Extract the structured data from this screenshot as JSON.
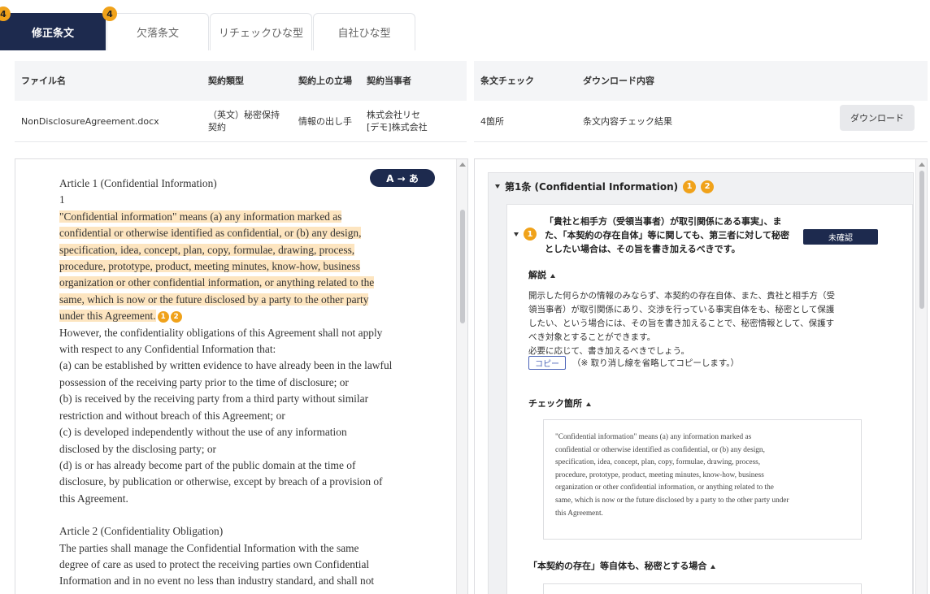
{
  "tabs": [
    {
      "label": "修正条文",
      "badge": "4",
      "active": true
    },
    {
      "label": "欠落条文",
      "badge": "4",
      "active": false
    },
    {
      "label": "リチェックひな型",
      "badge": "",
      "active": false
    },
    {
      "label": "自社ひな型",
      "badge": "",
      "active": false
    }
  ],
  "file_table": {
    "headers": [
      "ファイル名",
      "契約類型",
      "契約上の立場",
      "契約当事者"
    ],
    "file_name": "NonDisclosureAgreement.docx",
    "contract_type": [
      "（英文）秘密保持",
      "契約"
    ],
    "position": "情報の出し手",
    "parties": [
      "株式会社リセ",
      "[デモ]株式会社"
    ]
  },
  "check_table": {
    "headers": [
      "条文チェック",
      "ダウンロード内容"
    ],
    "count": "4箇所",
    "content": "条文内容チェック結果",
    "download_label": "ダウンロード"
  },
  "document": {
    "translate_label": "A → あ",
    "article1_title": "Article 1 (Confidential Information)",
    "article1_number": "1",
    "article1_highlighted": [
      "\"Confidential information\" means (a) any information marked as",
      "confidential or otherwise identified as confidential, or (b) any design,",
      "specification, idea, concept, plan, copy, formulae, drawing, process,",
      "procedure, prototype, product, meeting minutes, know-how, business",
      "organization or other confidential information, or anything related to the",
      "same, which is now or the future disclosed by a party to the other party",
      "under this Agreement."
    ],
    "refs": [
      "1",
      "2"
    ],
    "article1_rest": [
      "However, the confidentiality obligations of this Agreement shall not apply",
      "with respect to any Confidential Information that:",
      "(a) can be established by written evidence to have already been in the lawful",
      "possession of the receiving party prior to the time of disclosure; or",
      "(b) is received by the receiving party from a third party without similar",
      "restriction and without breach of this Agreement; or",
      "(c) is developed independently without the use of any information",
      "disclosed by the disclosing party; or",
      "(d) is or has already become part of the public domain at the time of",
      "disclosure, by publication or otherwise, except by breach of a provision of",
      "this Agreement."
    ],
    "article2_title": "Article 2 (Confidentiality Obligation)",
    "article2_lines": [
      "The parties shall manage the Confidential Information with the same",
      "degree of care as used to protect the receiving parties own Confidential",
      "Information and in no event no less than industry standard, and shall not"
    ]
  },
  "review": {
    "article_header": "第1条 (Confidential Information)",
    "article_badges": [
      "1",
      "2"
    ],
    "issue_badge": "1",
    "issue_lines": [
      "「貴社と相手方（受領当事者）が取引関係にある事実」、ま",
      "た、「本契約の存在自体」等に関しても、第三者に対して秘密",
      "としたい場合は、その旨を書き加えるべきです。"
    ],
    "status_label": "未確認",
    "explanation_title": "解説",
    "explanation_lines": [
      "開示した何らかの情報のみならず、本契約の存在自体、また、貴社と相手方（受",
      "領当事者）が取引関係にあり、交渉を行っている事実自体をも、秘密として保護",
      "したい、という場合には、その旨を書き加えることで、秘密情報として、保護す",
      "べき対象とすることができます。",
      "必要に応じて、書き加えるべきでしょう。"
    ],
    "copy_label": "コピー",
    "copy_note": "（※ 取り消し線を省略してコピーします。）",
    "check_title": "チェック箇所",
    "check_lines": [
      "\"Confidential information\" means (a) any information marked as",
      "confidential or otherwise identified as confidential, or (b) any design,",
      "specification, idea, concept, plan, copy, formulae, drawing, process,",
      "procedure, prototype, product, meeting minutes, know-how, business",
      "organization or other confidential information, or anything related to the",
      "same, which is now or the future disclosed by a party to the other party under",
      "this Agreement."
    ],
    "second_section_title": "「本契約の存在」等自体も、秘密とする場合"
  },
  "colors": {
    "navy": "#1d2a4e",
    "badge_orange": "#f0a21a",
    "highlight": "#fde5c0"
  }
}
